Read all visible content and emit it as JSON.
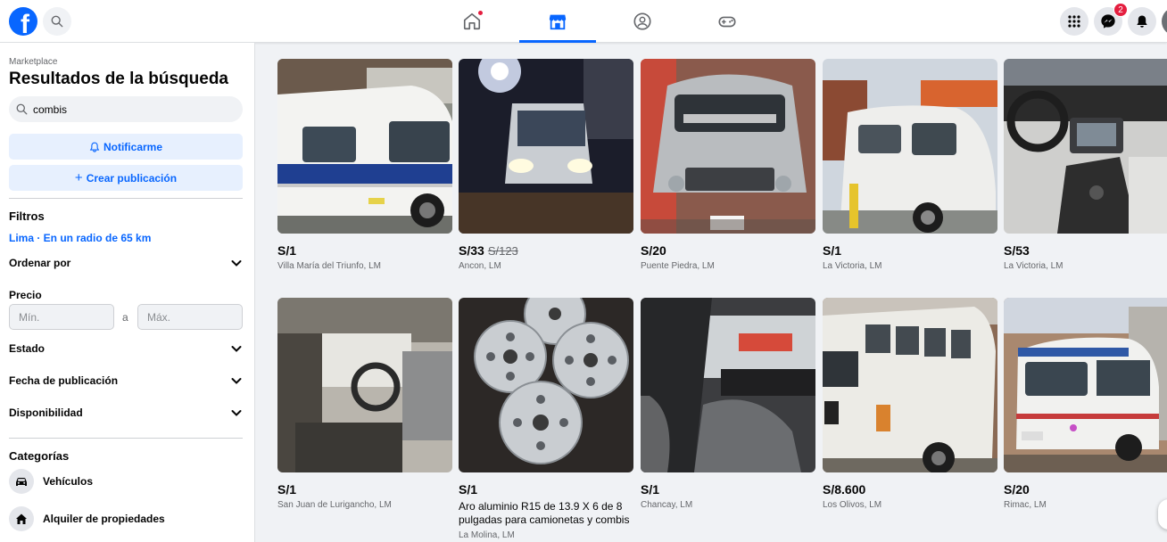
{
  "topbar": {
    "logo_letter": "f",
    "messenger_badge": "2"
  },
  "sidebar": {
    "breadcrumb": "Marketplace",
    "title": "Resultados de la búsqueda",
    "search_value": "combis",
    "notify_label": "Notificarme",
    "create_label": "Crear publicación",
    "filters_title": "Filtros",
    "location": "Lima · En un radio de 65 km",
    "sort_label": "Ordenar por",
    "price_label": "Precio",
    "min_placeholder": "Mín.",
    "max_placeholder": "Máx.",
    "price_separator": "a",
    "state_label": "Estado",
    "date_label": "Fecha de publicación",
    "availability_label": "Disponibilidad",
    "categories_title": "Categorías",
    "categories": [
      {
        "label": "Vehículos",
        "icon": "car-icon"
      },
      {
        "label": "Alquiler de propiedades",
        "icon": "house-icon"
      }
    ]
  },
  "listings": [
    {
      "price": "S/1",
      "old_price": "",
      "title": "",
      "location": "Villa María del Triunfo, LM",
      "photo": "white-blue-minibus"
    },
    {
      "price": "S/33",
      "old_price": "S/123",
      "title": "",
      "location": "Ancon, LM",
      "photo": "bus-at-night"
    },
    {
      "price": "S/20",
      "old_price": "",
      "title": "",
      "location": "Puente Piedra, LM",
      "photo": "silver-van-front"
    },
    {
      "price": "S/1",
      "old_price": "",
      "title": "",
      "location": "La Victoria, LM",
      "photo": "white-van-side"
    },
    {
      "price": "S/53",
      "old_price": "",
      "title": "",
      "location": "La Victoria, LM",
      "photo": "van-dashboard"
    },
    {
      "price": "S/1",
      "old_price": "",
      "title": "",
      "location": "San Juan de Lurigancho, LM",
      "photo": "truck-cabin"
    },
    {
      "price": "S/1",
      "old_price": "",
      "title": "Aro aluminio R15 de 13.9 X 6 de 8 pulgadas para camionetas y combis",
      "location": "La Molina, LM",
      "photo": "aluminum-rims"
    },
    {
      "price": "S/1",
      "old_price": "",
      "title": "",
      "location": "Chancay, LM",
      "photo": "van-interior"
    },
    {
      "price": "S/8.600",
      "old_price": "",
      "title": "",
      "location": "Los Olivos, LM",
      "photo": "vintage-white-van"
    },
    {
      "price": "S/20",
      "old_price": "",
      "title": "",
      "location": "Rimac, LM",
      "photo": "white-minibus-street"
    }
  ]
}
